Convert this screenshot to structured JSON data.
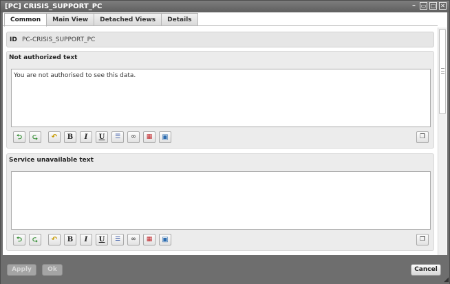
{
  "window": {
    "title": "[PC] CRISIS_SUPPORT_PC",
    "controls": {
      "minimize": "–",
      "restore": "▭",
      "maximize": "□",
      "close": "✕"
    }
  },
  "tabs": [
    {
      "label": "Common",
      "active": true
    },
    {
      "label": "Main View",
      "active": false
    },
    {
      "label": "Detached Views",
      "active": false
    },
    {
      "label": "Details",
      "active": false
    }
  ],
  "id_field": {
    "label": "ID",
    "value": "PC-CRISIS_SUPPORT_PC"
  },
  "sections": [
    {
      "title": "Not authorized text",
      "content": "You are not authorised to see this data."
    },
    {
      "title": "Service unavailable text",
      "content": ""
    }
  ],
  "toolbar_icons": [
    "undo-green-icon",
    "redo-green-icon",
    "undo-yellow-icon",
    "bold-icon",
    "italic-icon",
    "underline-icon",
    "bullet-list-icon",
    "link-icon",
    "calendar-icon",
    "image-icon",
    "maximize-editor-icon"
  ],
  "toolbar": {
    "undo": "⮌",
    "redo": "⮎",
    "revert": "↶",
    "bold": "B",
    "italic": "I",
    "underline": "U",
    "list": "☰",
    "link": "∞",
    "calendar": "▦",
    "image": "▣",
    "maximize": "❐"
  },
  "footer": {
    "apply_label": "Apply",
    "ok_label": "Ok",
    "cancel_label": "Cancel"
  },
  "colors": {
    "chrome": "#6e6e6e",
    "panel": "#ececec",
    "disabled_button": "#a4a4a4"
  }
}
